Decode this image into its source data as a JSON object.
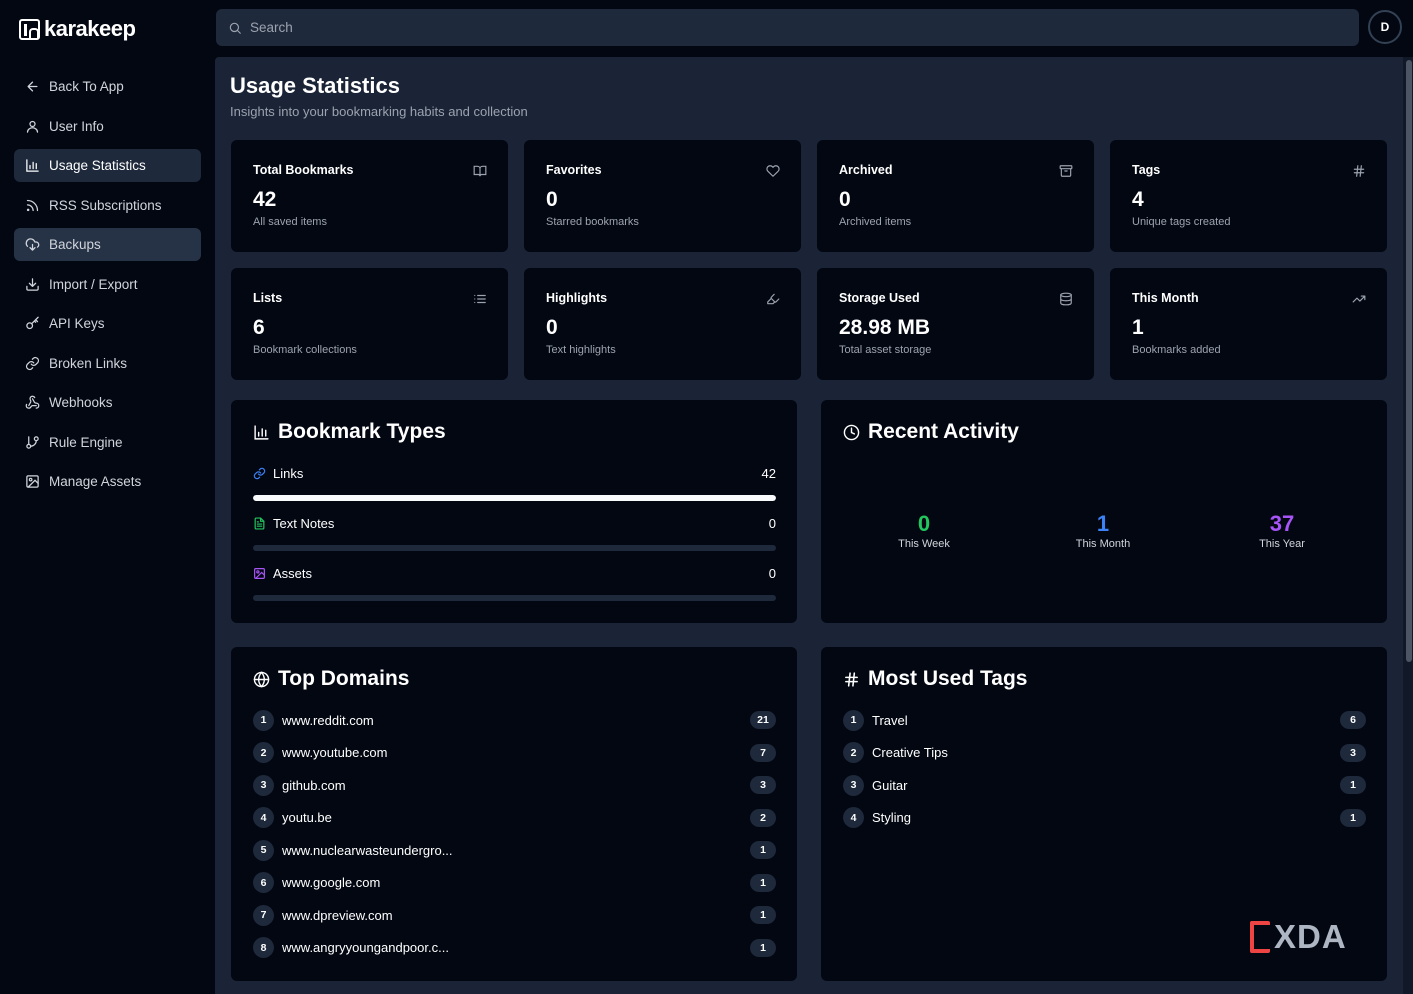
{
  "app": {
    "name": "karakeep"
  },
  "search": {
    "placeholder": "Search"
  },
  "user": {
    "initial": "D"
  },
  "sidebar": {
    "items": [
      {
        "label": "Back To App",
        "icon": "arrow-left-icon"
      },
      {
        "label": "User Info",
        "icon": "user-icon"
      },
      {
        "label": "Usage Statistics",
        "icon": "bar-chart-icon"
      },
      {
        "label": "RSS Subscriptions",
        "icon": "rss-icon"
      },
      {
        "label": "Backups",
        "icon": "cloud-download-icon"
      },
      {
        "label": "Import / Export",
        "icon": "download-icon"
      },
      {
        "label": "API Keys",
        "icon": "key-icon"
      },
      {
        "label": "Broken Links",
        "icon": "link-icon"
      },
      {
        "label": "Webhooks",
        "icon": "webhook-icon"
      },
      {
        "label": "Rule Engine",
        "icon": "git-branch-icon"
      },
      {
        "label": "Manage Assets",
        "icon": "image-icon"
      }
    ]
  },
  "page": {
    "title": "Usage Statistics",
    "subtitle": "Insights into your bookmarking habits and collection"
  },
  "stats": [
    {
      "label": "Total Bookmarks",
      "value": "42",
      "desc": "All saved items",
      "icon": "book-open-icon"
    },
    {
      "label": "Favorites",
      "value": "0",
      "desc": "Starred bookmarks",
      "icon": "heart-icon"
    },
    {
      "label": "Archived",
      "value": "0",
      "desc": "Archived items",
      "icon": "archive-icon"
    },
    {
      "label": "Tags",
      "value": "4",
      "desc": "Unique tags created",
      "icon": "hash-icon"
    },
    {
      "label": "Lists",
      "value": "6",
      "desc": "Bookmark collections",
      "icon": "list-icon"
    },
    {
      "label": "Highlights",
      "value": "0",
      "desc": "Text highlights",
      "icon": "highlighter-icon"
    },
    {
      "label": "Storage Used",
      "value": "28.98 MB",
      "desc": "Total asset storage",
      "icon": "database-icon"
    },
    {
      "label": "This Month",
      "value": "1",
      "desc": "Bookmarks added",
      "icon": "trending-up-icon"
    }
  ],
  "bookmark_types": {
    "title": "Bookmark Types",
    "items": [
      {
        "label": "Links",
        "count": "42",
        "fraction": 1.0,
        "icon": "link-icon",
        "color": "#3b82f6"
      },
      {
        "label": "Text Notes",
        "count": "0",
        "fraction": 0.0,
        "icon": "file-text-icon",
        "color": "#22c55e"
      },
      {
        "label": "Assets",
        "count": "0",
        "fraction": 0.0,
        "icon": "image-icon",
        "color": "#a855f7"
      }
    ]
  },
  "recent_activity": {
    "title": "Recent Activity",
    "items": [
      {
        "value": "0",
        "label": "This Week",
        "color": "#22c55e"
      },
      {
        "value": "1",
        "label": "This Month",
        "color": "#3b82f6"
      },
      {
        "value": "37",
        "label": "This Year",
        "color": "#a855f7"
      }
    ]
  },
  "top_domains": {
    "title": "Top Domains",
    "items": [
      {
        "rank": "1",
        "name": "www.reddit.com",
        "count": "21"
      },
      {
        "rank": "2",
        "name": "www.youtube.com",
        "count": "7"
      },
      {
        "rank": "3",
        "name": "github.com",
        "count": "3"
      },
      {
        "rank": "4",
        "name": "youtu.be",
        "count": "2"
      },
      {
        "rank": "5",
        "name": "www.nuclearwasteundergro...",
        "count": "1"
      },
      {
        "rank": "6",
        "name": "www.google.com",
        "count": "1"
      },
      {
        "rank": "7",
        "name": "www.dpreview.com",
        "count": "1"
      },
      {
        "rank": "8",
        "name": "www.angryyoungandpoor.c...",
        "count": "1"
      }
    ]
  },
  "most_used_tags": {
    "title": "Most Used Tags",
    "items": [
      {
        "rank": "1",
        "name": "Travel",
        "count": "6"
      },
      {
        "rank": "2",
        "name": "Creative Tips",
        "count": "3"
      },
      {
        "rank": "3",
        "name": "Guitar",
        "count": "1"
      },
      {
        "rank": "4",
        "name": "Styling",
        "count": "1"
      }
    ]
  },
  "watermark": {
    "text": "XDA"
  }
}
